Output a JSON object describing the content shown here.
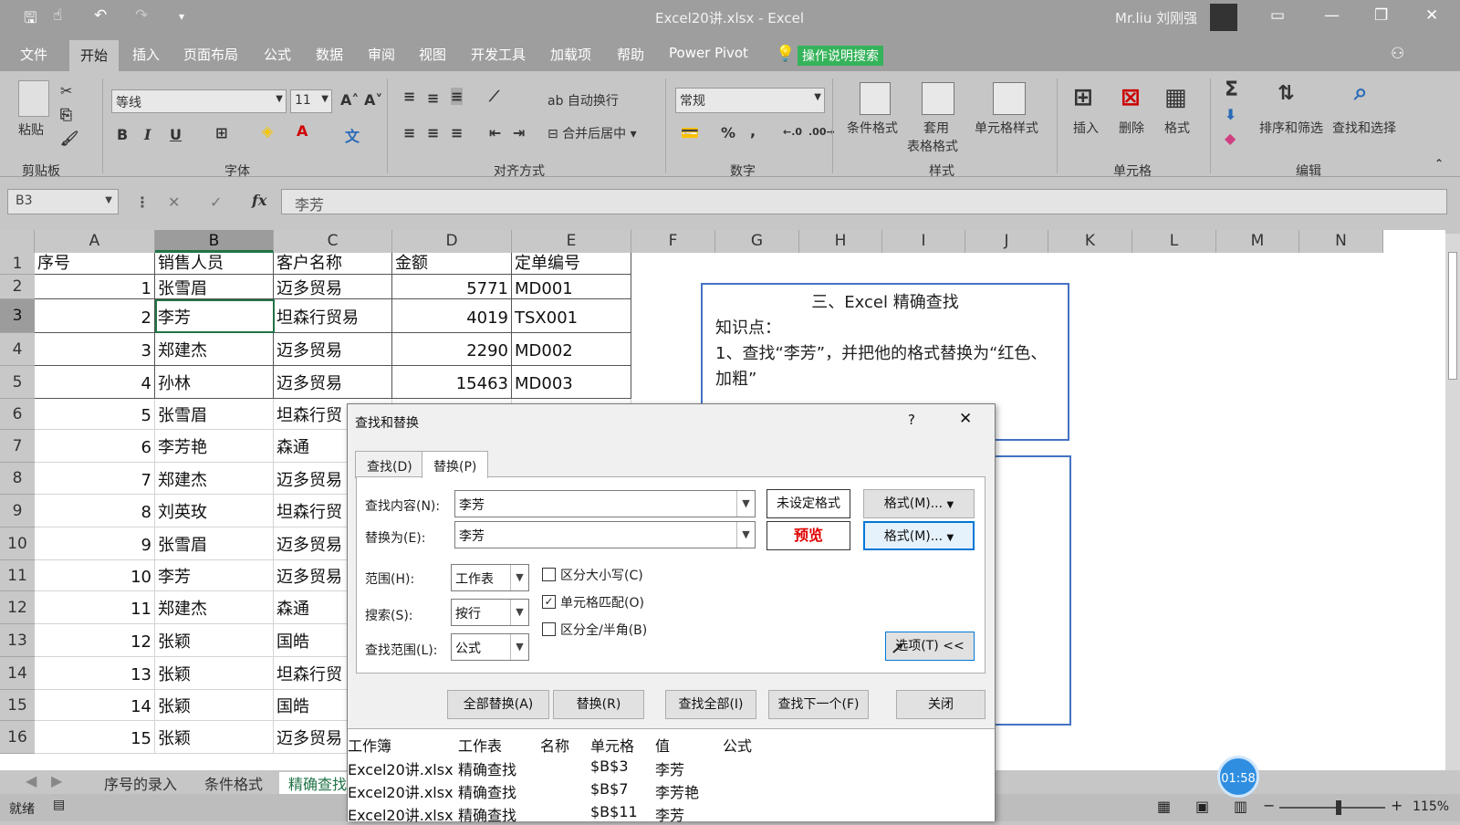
{
  "title_bar": {
    "doc_title": "Excel20讲.xlsx  -  Excel",
    "user": "Mr.liu 刘刚强"
  },
  "menu": {
    "tabs": [
      "文件",
      "开始",
      "插入",
      "页面布局",
      "公式",
      "数据",
      "审阅",
      "视图",
      "开发工具",
      "加载项",
      "帮助",
      "Power Pivot"
    ],
    "search_label": "操作说明搜索"
  },
  "ribbon": {
    "clipboard": {
      "paste": "粘贴",
      "group": "剪贴板"
    },
    "font": {
      "name": "等线",
      "size": "11",
      "bold": "B",
      "italic": "I",
      "underline": "U",
      "group": "字体"
    },
    "align": {
      "wrap": "自动换行",
      "merge": "合并后居中",
      "group": "对齐方式"
    },
    "number": {
      "format": "常规",
      "percent": "%",
      "comma": ",",
      "group": "数字"
    },
    "styles": {
      "cond": "条件格式",
      "table1": "套用",
      "table2": "表格格式",
      "cell": "单元格样式",
      "group": "样式"
    },
    "cells": {
      "insert": "插入",
      "delete": "删除",
      "format": "格式",
      "group": "单元格"
    },
    "edit": {
      "sort": "排序和筛选",
      "find": "查找和选择",
      "group": "编辑"
    }
  },
  "formula_bar": {
    "name_box": "B3",
    "content": "李芳"
  },
  "columns": [
    "A",
    "B",
    "C",
    "D",
    "E",
    "F",
    "G",
    "H",
    "I",
    "J",
    "K",
    "L",
    "M",
    "N"
  ],
  "rows": [
    {
      "n": "1",
      "a": "序号",
      "b": "销售人员",
      "c": "客户名称",
      "d": "金额",
      "e": "定单编号"
    },
    {
      "n": "2",
      "a": "1",
      "b": "张雪眉",
      "c": "迈多贸易",
      "d": "5771",
      "e": "MD001"
    },
    {
      "n": "3",
      "a": "2",
      "b": "李芳",
      "c": "坦森行贸易",
      "d": "4019",
      "e": "TSX001"
    },
    {
      "n": "4",
      "a": "3",
      "b": "郑建杰",
      "c": "迈多贸易",
      "d": "2290",
      "e": "MD002"
    },
    {
      "n": "5",
      "a": "4",
      "b": "孙林",
      "c": "迈多贸易",
      "d": "15463",
      "e": "MD003"
    },
    {
      "n": "6",
      "a": "5",
      "b": "张雪眉",
      "c": "坦森行贸",
      "d": "",
      "e": ""
    },
    {
      "n": "7",
      "a": "6",
      "b": "李芳艳",
      "c": "森通",
      "d": "",
      "e": ""
    },
    {
      "n": "8",
      "a": "7",
      "b": "郑建杰",
      "c": "迈多贸易",
      "d": "",
      "e": ""
    },
    {
      "n": "9",
      "a": "8",
      "b": "刘英玫",
      "c": "坦森行贸",
      "d": "",
      "e": ""
    },
    {
      "n": "10",
      "a": "9",
      "b": "张雪眉",
      "c": "迈多贸易",
      "d": "",
      "e": ""
    },
    {
      "n": "11",
      "a": "10",
      "b": "李芳",
      "c": "迈多贸易",
      "d": "",
      "e": ""
    },
    {
      "n": "12",
      "a": "11",
      "b": "郑建杰",
      "c": "森通",
      "d": "",
      "e": ""
    },
    {
      "n": "13",
      "a": "12",
      "b": "张颖",
      "c": "国皓",
      "d": "",
      "e": ""
    },
    {
      "n": "14",
      "a": "13",
      "b": "张颖",
      "c": "坦森行贸",
      "d": "",
      "e": ""
    },
    {
      "n": "15",
      "a": "14",
      "b": "张颖",
      "c": "国皓",
      "d": "",
      "e": ""
    },
    {
      "n": "16",
      "a": "15",
      "b": "张颖",
      "c": "迈多贸易",
      "d": "",
      "e": ""
    }
  ],
  "note": {
    "title": "三、Excel 精确查找",
    "line1": "知识点：",
    "line2": "1、查找“李芳”，并把他的格式替换为“红色、加粗”"
  },
  "sheet_tabs": [
    "序号的录入",
    "条件格式",
    "精确查找"
  ],
  "status": {
    "ready": "就绪",
    "zoom": "115%",
    "timer": "01:58"
  },
  "dialog": {
    "title": "查找和替换",
    "help": "?",
    "tab_find": "查找(D)",
    "tab_replace": "替换(P)",
    "find_label": "查找内容(N):",
    "find_value": "李芳",
    "replace_label": "替换为(E):",
    "replace_value": "李芳",
    "no_format": "未设定格式",
    "preview": "预览",
    "format_btn": "格式(M)...",
    "within_label": "范围(H):",
    "within_value": "工作表",
    "search_label": "搜索(S):",
    "search_value": "按行",
    "lookin_label": "查找范围(L):",
    "lookin_value": "公式",
    "match_case": "区分大小写(C)",
    "match_cell": "单元格匹配(O)",
    "match_byte": "区分全/半角(B)",
    "options": "选项(T) <<",
    "replace_all": "全部替换(A)",
    "replace": "替换(R)",
    "find_all": "查找全部(I)",
    "find_next": "查找下一个(F)",
    "close": "关闭",
    "results_headers": [
      "工作簿",
      "工作表",
      "名称",
      "单元格",
      "值",
      "公式"
    ],
    "results": [
      {
        "book": "Excel20讲.xlsx",
        "sheet": "精确查找",
        "cell": "$B$3",
        "value": "李芳"
      },
      {
        "book": "Excel20讲.xlsx",
        "sheet": "精确查找",
        "cell": "$B$7",
        "value": "李芳艳"
      },
      {
        "book": "Excel20讲.xlsx",
        "sheet": "精确查找",
        "cell": "$B$11",
        "value": "李芳"
      }
    ]
  }
}
